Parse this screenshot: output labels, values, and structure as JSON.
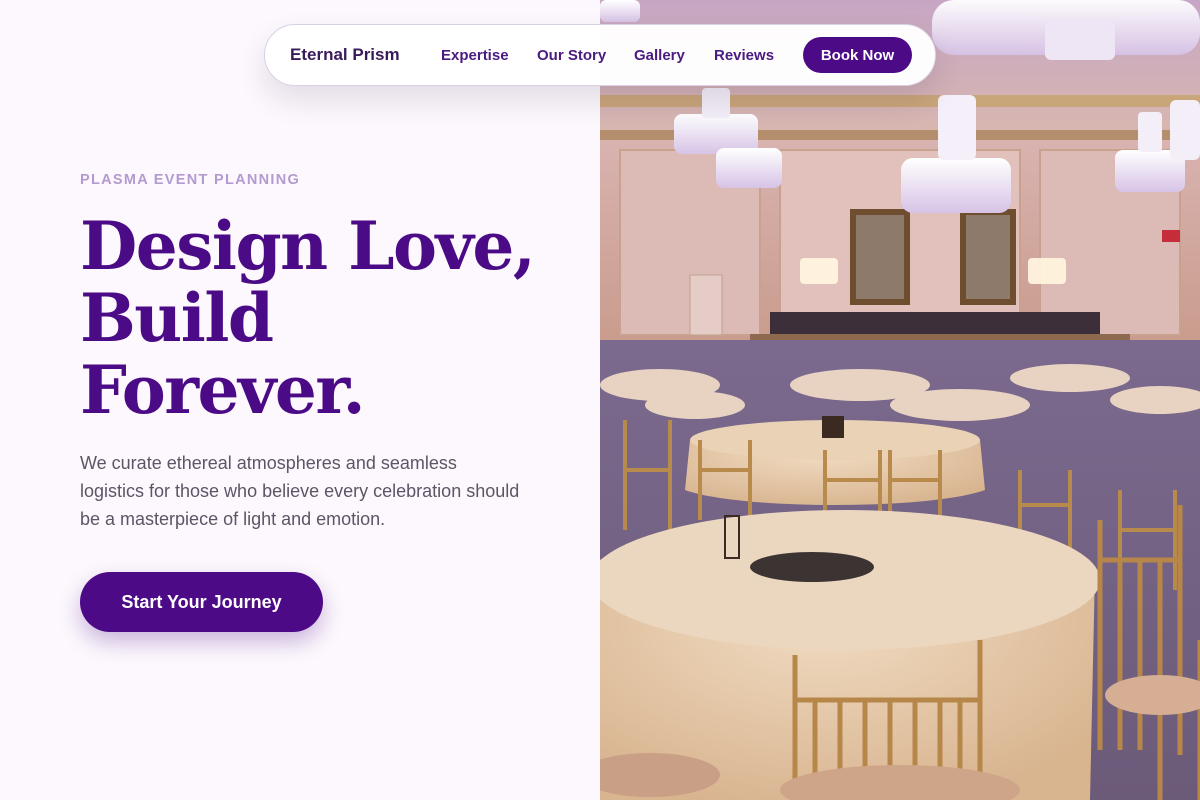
{
  "nav": {
    "brand": "Eternal Prism",
    "links": [
      "Expertise",
      "Our Story",
      "Gallery",
      "Reviews"
    ],
    "cta": "Book Now"
  },
  "hero": {
    "eyebrow": "PLASMA EVENT PLANNING",
    "headline": [
      "Design Love,",
      "Build",
      "Forever."
    ],
    "description": "We curate ethereal atmospheres and seamless logistics for those who believe every celebration should be a masterpiece of light and emotion.",
    "cta": "Start Your Journey"
  },
  "image": {
    "subject": "banquet-hall-photo"
  },
  "colors": {
    "accent": "#4c0a87",
    "headline": "#4b0b86",
    "eyebrow": "#b39ad0",
    "body_text": "#5b5566",
    "background": "#fcf8fd"
  }
}
